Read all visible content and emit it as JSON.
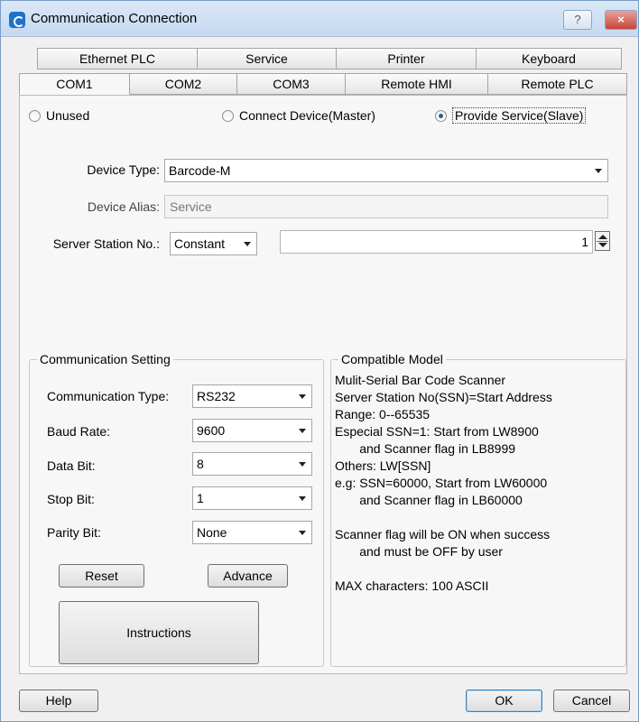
{
  "window": {
    "title": "Communication Connection",
    "help_glyph": "?",
    "close_glyph": "×"
  },
  "tabs": {
    "row1": [
      "Ethernet PLC",
      "Service",
      "Printer",
      "Keyboard"
    ],
    "row2": [
      "COM1",
      "COM2",
      "COM3",
      "Remote HMI",
      "Remote PLC"
    ],
    "active": "COM1"
  },
  "mode": {
    "options": [
      "Unused",
      "Connect Device(Master)",
      "Provide Service(Slave)"
    ],
    "selected": "Provide Service(Slave)"
  },
  "device": {
    "type_label": "Device Type:",
    "type_value": "Barcode-M",
    "alias_label": "Device Alias:",
    "alias_value": "Service",
    "station_label": "Server Station No.:",
    "station_mode": "Constant",
    "station_value": "1"
  },
  "comm": {
    "title": "Communication Setting",
    "type_label": "Communication Type:",
    "type_value": "RS232",
    "baud_label": "Baud Rate:",
    "baud_value": "9600",
    "data_label": "Data Bit:",
    "data_value": "8",
    "stop_label": "Stop Bit:",
    "stop_value": "1",
    "parity_label": "Parity Bit:",
    "parity_value": "None",
    "reset_label": "Reset",
    "advance_label": "Advance",
    "instructions_label": "Instructions"
  },
  "compat": {
    "title": "Compatible Model",
    "lines": [
      "Mulit-Serial Bar Code Scanner",
      "Server Station No(SSN)=Start Address",
      "Range: 0--65535",
      "Especial SSN=1: Start from LW8900",
      "       and Scanner flag in LB8999",
      "Others: LW[SSN]",
      "e.g: SSN=60000, Start from LW60000",
      "       and Scanner flag in LB60000",
      "",
      "Scanner flag will be ON when success",
      "       and must be OFF by user",
      "",
      "MAX characters: 100 ASCII"
    ]
  },
  "footer": {
    "help_label": "Help",
    "ok_label": "OK",
    "cancel_label": "Cancel"
  }
}
